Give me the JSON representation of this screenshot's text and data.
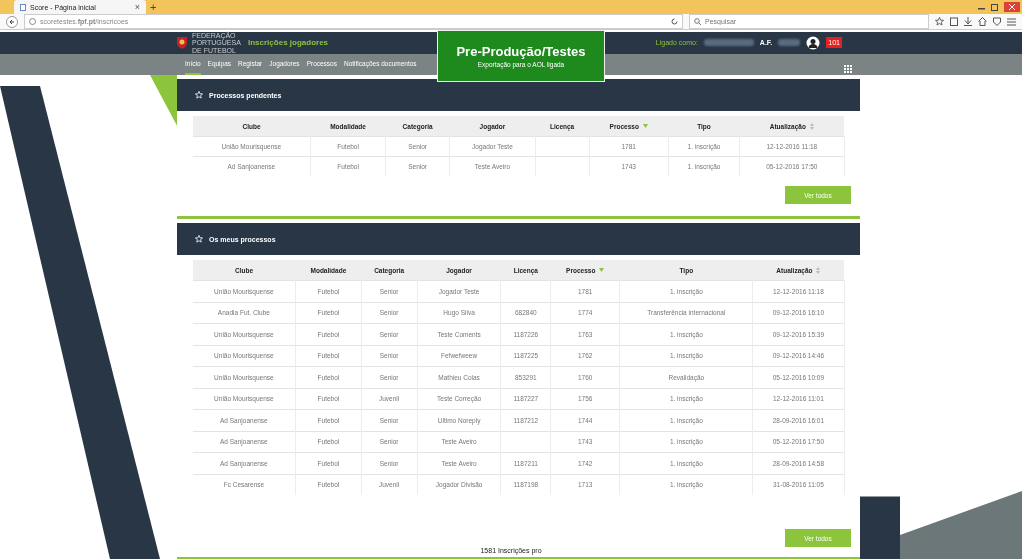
{
  "browser": {
    "tab_title": "Score - Página inicial",
    "tab_close": "×",
    "new_tab": "+",
    "url": "scoretestes.**fpf.pt**/inscricoes",
    "search": {
      "placeholder": "Pesquisar"
    }
  },
  "header": {
    "logo_text": "FEDERAÇÃO PORTUGUESA DE FUTEBOL",
    "app_title": "Inscrições jogadores",
    "env_title": "Pre-Produção/Testes",
    "env_subtitle": "Exportação para o AOL ligada",
    "logged_label": "Ligado como:",
    "user_initials": "A.F.",
    "badge": "101"
  },
  "nav": [
    {
      "label": "Início",
      "selected": true
    },
    {
      "label": "Equipas",
      "selected": false
    },
    {
      "label": "Registar",
      "selected": false
    },
    {
      "label": "Jogadores",
      "selected": false
    },
    {
      "label": "Processos",
      "selected": false
    },
    {
      "label": "Notificações documentos",
      "selected": false
    }
  ],
  "sections": [
    {
      "title": "Processos pendentes",
      "columns": [
        "Clube",
        "Modalidade",
        "Categoria",
        "Jogador",
        "Licença",
        "Processo",
        "Tipo",
        "Atualização"
      ],
      "button": "Ver todos",
      "rows": [
        [
          "União Mourisquense",
          "Futebol",
          "Senior",
          "Jogador Teste",
          "",
          "1781",
          "1. inscrição",
          "12-12-2016 11:18"
        ],
        [
          "Ad Sanjoanense",
          "Futebol",
          "Senior",
          "Teste Aveiro",
          "",
          "1743",
          "1. inscrição",
          "05-12-2016 17:50"
        ]
      ]
    },
    {
      "title": "Os meus processos",
      "columns": [
        "Clube",
        "Modalidade",
        "Categoria",
        "Jogador",
        "Licença",
        "Processo",
        "Tipo",
        "Atualização"
      ],
      "button": "Ver todos",
      "rows": [
        [
          "União Mourisquense",
          "Futebol",
          "Senior",
          "Jogador Teste",
          "",
          "1781",
          "1. inscrição",
          "12-12-2016 11:18"
        ],
        [
          "Anadia Fut. Clube",
          "Futebol",
          "Senior",
          "Hugo Silva",
          "682840",
          "1774",
          "Transferência internacional",
          "09-12-2016 16:10"
        ],
        [
          "União Mourisquense",
          "Futebol",
          "Senior",
          "Teste Coments",
          "1187226",
          "1763",
          "1. inscrição",
          "09-12-2016 15:39"
        ],
        [
          "União Mourisquense",
          "Futebol",
          "Senior",
          "Fefwefweew",
          "1187225",
          "1762",
          "1. inscrição",
          "09-12-2016 14:46"
        ],
        [
          "União Mourisquense",
          "Futebol",
          "Senior",
          "Mathieu Colas",
          "853291",
          "1760",
          "Revalidação",
          "05-12-2016 10:09"
        ],
        [
          "União Mourisquense",
          "Futebol",
          "Juvenil",
          "Teste Correção",
          "1187227",
          "1756",
          "1. inscrição",
          "12-12-2016 11:01"
        ],
        [
          "Ad Sanjoanense",
          "Futebol",
          "Senior",
          "Ultimo Noreply",
          "1187212",
          "1744",
          "1. inscrição",
          "28-09-2016 16:01"
        ],
        [
          "Ad Sanjoanense",
          "Futebol",
          "Senior",
          "Teste Aveiro",
          "",
          "1743",
          "1. inscrição",
          "05-12-2016 17:50"
        ],
        [
          "Ad Sanjoanense",
          "Futebol",
          "Senior",
          "Teste Aveiro",
          "1187211",
          "1742",
          "1. inscrição",
          "28-09-2016 14:58"
        ],
        [
          "Fc Cesarense",
          "Futebol",
          "Juvenil",
          "Jogador Divisão",
          "1187198",
          "1713",
          "1. inscrição",
          "31-08-2016 11:05"
        ]
      ]
    }
  ],
  "footer": "1581 Inscrições pro"
}
